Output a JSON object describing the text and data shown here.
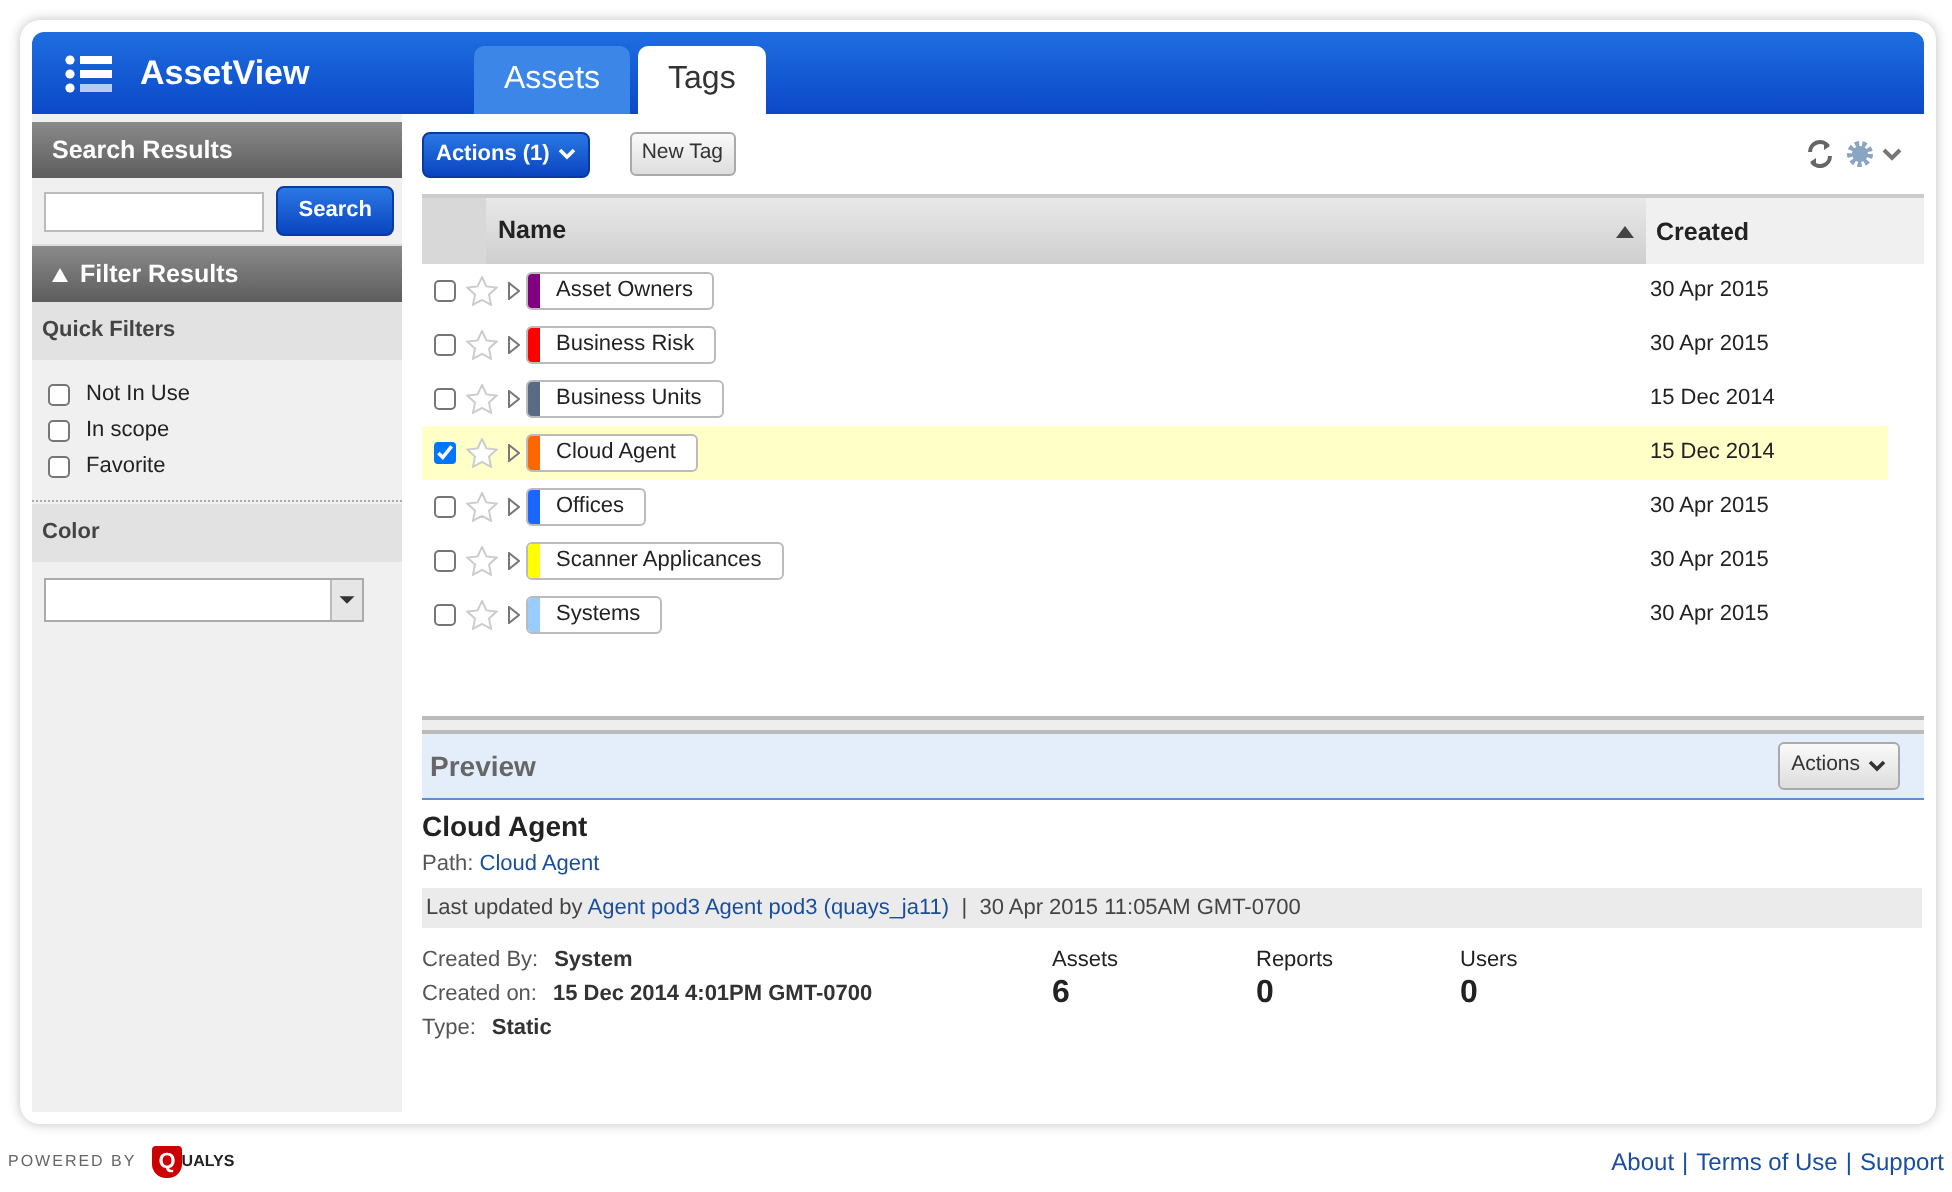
{
  "app": {
    "title": "AssetView"
  },
  "tabs": [
    {
      "label": "Assets",
      "selected": false
    },
    {
      "label": "Tags",
      "selected": true
    }
  ],
  "sidebar": {
    "search_title": "Search Results",
    "search_button": "Search",
    "filter_title": "Filter Results",
    "filter_expanded": true,
    "quick_filters_title": "Quick Filters",
    "quick_filters": [
      {
        "label": "Not In Use",
        "checked": false
      },
      {
        "label": "In scope",
        "checked": false
      },
      {
        "label": "Favorite",
        "checked": false
      }
    ],
    "color_title": "Color"
  },
  "toolbar": {
    "actions": "Actions (1)",
    "new_tag": "New Tag"
  },
  "table": {
    "columns": [
      "Name",
      "Created"
    ],
    "rows": [
      {
        "name": "Asset Owners",
        "color": "#800080",
        "created": "30 Apr 2015",
        "selected": false,
        "favorite": false
      },
      {
        "name": "Business Risk",
        "color": "#ff0000",
        "created": "30 Apr 2015",
        "selected": false,
        "favorite": false
      },
      {
        "name": "Business Units",
        "color": "#5a6b86",
        "created": "15 Dec 2014",
        "selected": false,
        "favorite": false
      },
      {
        "name": "Cloud Agent",
        "color": "#ff6600",
        "created": "15 Dec 2014",
        "selected": true,
        "favorite": false
      },
      {
        "name": "Offices",
        "color": "#1a66ff",
        "created": "30 Apr 2015",
        "selected": false,
        "favorite": false
      },
      {
        "name": "Scanner Applicances",
        "color": "#ffff00",
        "created": "30 Apr 2015",
        "selected": false,
        "favorite": false
      },
      {
        "name": "Systems",
        "color": "#99ccff",
        "created": "30 Apr 2015",
        "selected": false,
        "favorite": false
      }
    ]
  },
  "preview": {
    "title": "Preview",
    "actions": "Actions",
    "name": "Cloud Agent",
    "path_label": "Path:",
    "path": "Cloud Agent",
    "updated_prefix": "Last updated by",
    "updated_by": "Agent pod3 Agent pod3 (quays_ja11)",
    "updated_sep": "|",
    "updated_at": "30 Apr 2015 11:05AM GMT-0700",
    "details": [
      {
        "label": "Created By:",
        "value": "System"
      },
      {
        "label": "Created on:",
        "value": "15 Dec 2014 4:01PM GMT-0700"
      },
      {
        "label": "Type:",
        "value": "Static"
      }
    ],
    "stats": [
      {
        "label": "Assets",
        "value": "6"
      },
      {
        "label": "Reports",
        "value": "0"
      },
      {
        "label": "Users",
        "value": "0"
      }
    ]
  },
  "footer": {
    "powered_by": "POWERED BY",
    "logo_mark": "Q",
    "logo_text": "UALYS",
    "links": [
      "About",
      "Terms of Use",
      "Support"
    ],
    "separator": "|"
  }
}
